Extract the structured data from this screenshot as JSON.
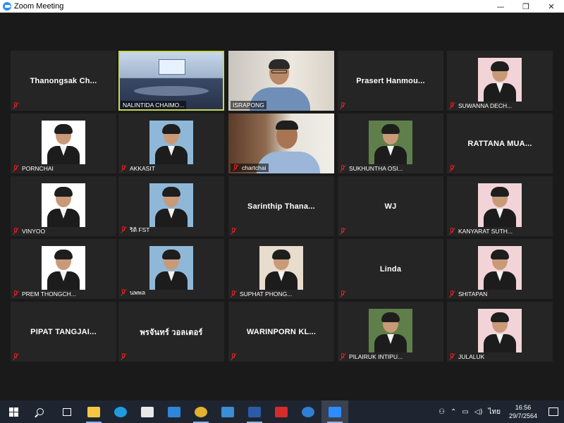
{
  "window": {
    "title": "Zoom Meeting",
    "minimize_glyph": "—",
    "restore_glyph": "❐",
    "close_glyph": "✕"
  },
  "participants": [
    {
      "name": "Thanongsak  Ch...",
      "label": "",
      "video": false,
      "muted": true
    },
    {
      "name": "",
      "label": "NALINTIDA CHAIMO...",
      "video": true,
      "muted": false,
      "active_speaker": true
    },
    {
      "name": "",
      "label": "ISRAPONG",
      "video": true,
      "muted": false
    },
    {
      "name": "Prasert  Hanmou...",
      "label": "",
      "video": false,
      "muted": true
    },
    {
      "name": "",
      "label": "SUWANNA DECH...",
      "video": false,
      "photo": true,
      "muted": true
    },
    {
      "name": "",
      "label": "PORNCHAI",
      "video": false,
      "photo": true,
      "muted": true
    },
    {
      "name": "",
      "label": "AKKASIT",
      "video": false,
      "photo": true,
      "muted": true
    },
    {
      "name": "",
      "label": "chartchai",
      "video": true,
      "muted": true
    },
    {
      "name": "",
      "label": "SUKHUNTHA OSI...",
      "video": false,
      "photo": true,
      "muted": true
    },
    {
      "name": "RATTANA  MUA...",
      "label": "",
      "video": false,
      "muted": true
    },
    {
      "name": "",
      "label": "VINYOO",
      "video": false,
      "photo": true,
      "muted": true
    },
    {
      "name": "",
      "label": "ริติ FST",
      "video": false,
      "photo": true,
      "muted": true
    },
    {
      "name": "Sarinthip  Thana...",
      "label": "",
      "video": false,
      "muted": true
    },
    {
      "name": "WJ",
      "label": "",
      "video": false,
      "muted": true
    },
    {
      "name": "",
      "label": "KANYARAT SUTH...",
      "video": false,
      "photo": true,
      "muted": true
    },
    {
      "name": "",
      "label": "PREM THONGCH...",
      "video": false,
      "photo": true,
      "muted": true
    },
    {
      "name": "",
      "label": "นพพล",
      "video": false,
      "photo": true,
      "muted": true
    },
    {
      "name": "",
      "label": "SUPHAT PHONG...",
      "video": false,
      "photo": true,
      "muted": true
    },
    {
      "name": "Linda",
      "label": "",
      "video": false,
      "muted": true
    },
    {
      "name": "",
      "label": "SHITAPAN",
      "video": false,
      "photo": true,
      "muted": true
    },
    {
      "name": "PIPAT  TANGJAI...",
      "label": "",
      "video": false,
      "muted": true
    },
    {
      "name": "พรจันทร์  วอลเตอร์",
      "label": "",
      "video": false,
      "muted": true
    },
    {
      "name": "WARINPORN  KL...",
      "label": "",
      "video": false,
      "muted": true
    },
    {
      "name": "",
      "label": "PILAIRUK INTIPU...",
      "video": false,
      "photo": true,
      "muted": true
    },
    {
      "name": "",
      "label": "JULALUK",
      "video": false,
      "photo": true,
      "muted": true
    }
  ],
  "taskbar": {
    "apps": [
      {
        "name": "file-explorer-icon",
        "color": "#f3c744"
      },
      {
        "name": "edge-icon",
        "color": "#1f9be0"
      },
      {
        "name": "store-icon",
        "color": "#e8e8e8"
      },
      {
        "name": "mail-icon",
        "color": "#2f86d8"
      },
      {
        "name": "chrome-icon",
        "color": "#e4b032"
      },
      {
        "name": "photos-icon",
        "color": "#3a8ed6"
      },
      {
        "name": "word-icon",
        "color": "#2b5ba8"
      },
      {
        "name": "acrobat-icon",
        "color": "#d42b2b"
      },
      {
        "name": "help-icon",
        "color": "#2f7fd6"
      },
      {
        "name": "zoom-icon",
        "color": "#2d8cff"
      }
    ],
    "language": "ไทย",
    "time": "16:56",
    "date": "29/7/2564"
  }
}
